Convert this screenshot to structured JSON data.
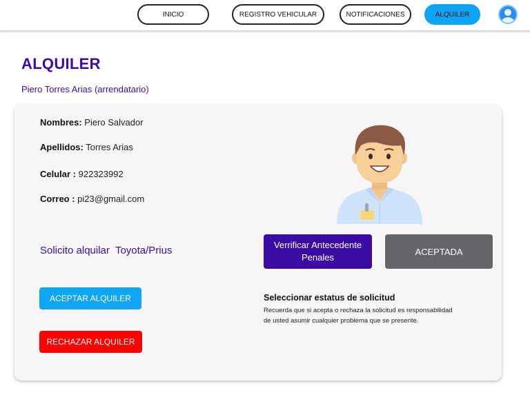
{
  "nav": {
    "inicio": "INICIO",
    "registro": "REGISTRO VEHICULAR",
    "notificaciones": "NOTIFICACIONES",
    "alquiler": "ALQUILER",
    "avatar_icon": "user-avatar-icon"
  },
  "page": {
    "title": "ALQUILER",
    "subtitle": "Piero Torres Arias (arrendatario)"
  },
  "profile": {
    "nombres_label": "Nombres:",
    "nombres_value": " Piero Salvador",
    "apellidos_label": "Apellidos:",
    "apellidos_value": " Torres Arias",
    "celular_label": "Celular :",
    "celular_value": " 922323992",
    "correo_label": "Correo :",
    "correo_value": "  pi23@gmail.com"
  },
  "request": {
    "text": "Solicito alquilar  Toyota/Prius"
  },
  "actions": {
    "accept": "ACEPTAR ALQUILER",
    "reject": "RECHAZAR ALQUILER",
    "verify": "Verrificar Antecedente Penales",
    "status": "ACEPTADA"
  },
  "status_info": {
    "title": "Seleccionar estatus de solicitud",
    "note": "Recuerda que si acepta o rechaza la solicitud  es responsabilidad de usted asumir cualquier problema que se presente."
  },
  "colors": {
    "brand": "#3a0ca3",
    "accent": "#10a6f6",
    "danger": "#ff0000",
    "status": "#666469"
  }
}
